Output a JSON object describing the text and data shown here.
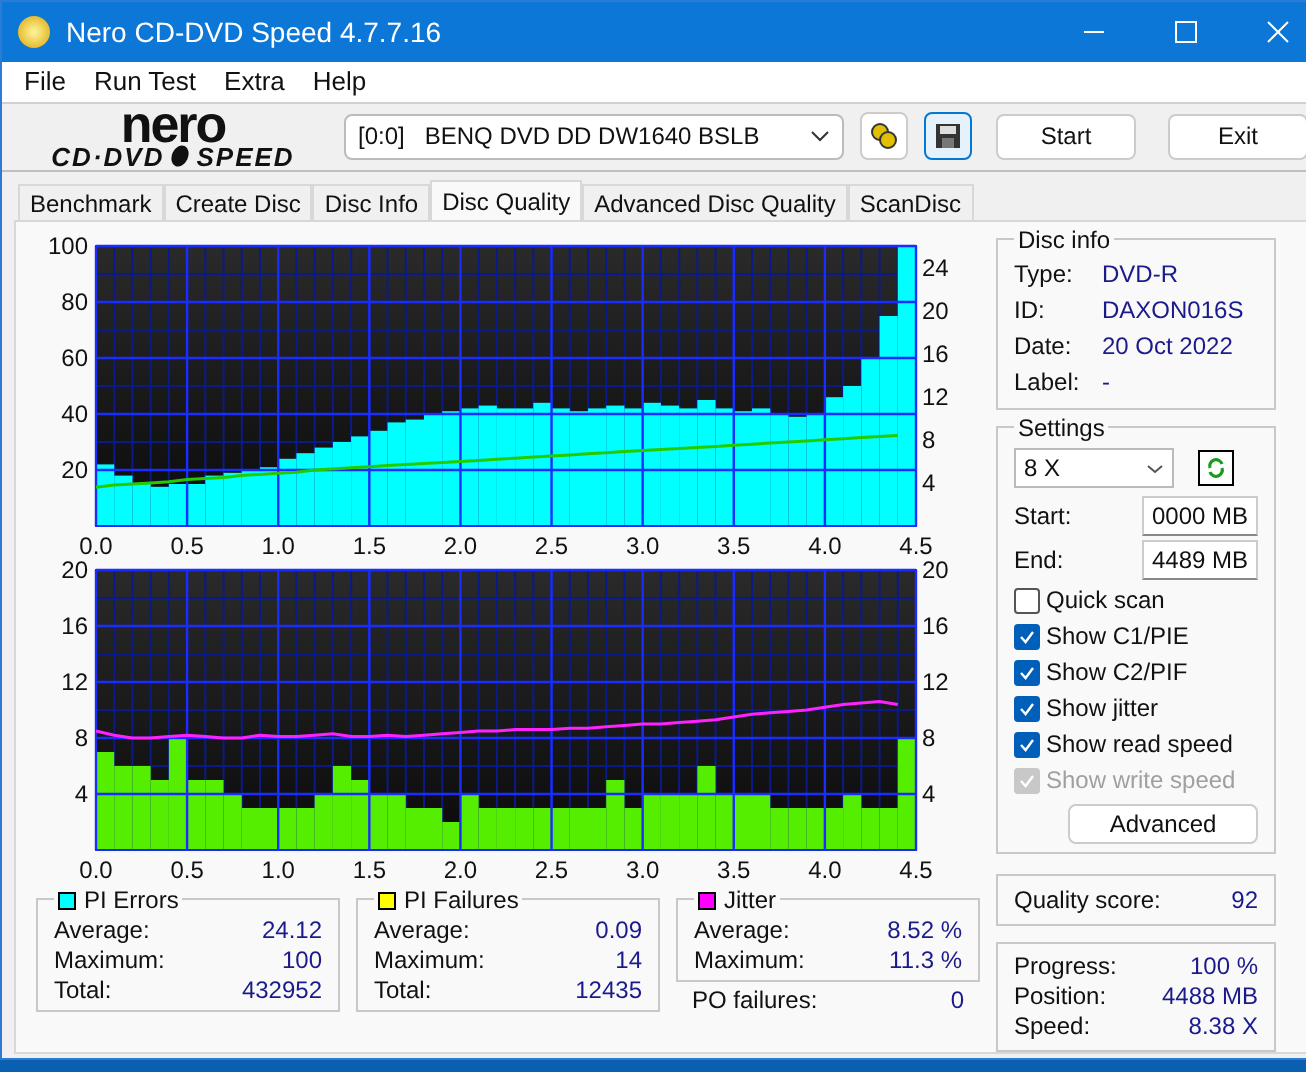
{
  "window": {
    "title": "Nero CD-DVD Speed 4.7.7.16"
  },
  "menu": [
    "File",
    "Run Test",
    "Extra",
    "Help"
  ],
  "toolbar": {
    "logo_top": "nero",
    "logo_bottom": "CD·DVD",
    "logo_speed": "SPEED",
    "drive": "[0:0]   BENQ DVD DD DW1640 BSLB",
    "start": "Start",
    "exit": "Exit"
  },
  "tabs": [
    {
      "label": "Benchmark",
      "selected": false
    },
    {
      "label": "Create Disc",
      "selected": false
    },
    {
      "label": "Disc Info",
      "selected": false
    },
    {
      "label": "Disc Quality",
      "selected": true
    },
    {
      "label": "Advanced Disc Quality",
      "selected": false
    },
    {
      "label": "ScanDisc",
      "selected": false
    }
  ],
  "charts": [
    {
      "chart_data": {
        "type": "bar",
        "grid": true,
        "xlim": [
          0,
          4.5
        ],
        "ylim": [
          0,
          100
        ],
        "xticks": [
          {
            "value": 0,
            "label": "0.0"
          },
          {
            "value": 0.5,
            "label": "0.5"
          },
          {
            "value": 1,
            "label": "1.0"
          },
          {
            "value": 1.5,
            "label": "1.5"
          },
          {
            "value": 2,
            "label": "2.0"
          },
          {
            "value": 2.5,
            "label": "2.5"
          },
          {
            "value": 3,
            "label": "3.0"
          },
          {
            "value": 3.5,
            "label": "3.5"
          },
          {
            "value": 4,
            "label": "4.0"
          },
          {
            "value": 4.5,
            "label": "4.5"
          }
        ],
        "yticks": [
          20,
          40,
          60,
          80,
          100
        ],
        "x": [
          0.05,
          0.15,
          0.25,
          0.35,
          0.45,
          0.55,
          0.65,
          0.75,
          0.85,
          0.95,
          1.05,
          1.15,
          1.25,
          1.35,
          1.45,
          1.55,
          1.65,
          1.75,
          1.85,
          1.95,
          2.05,
          2.15,
          2.25,
          2.35,
          2.45,
          2.55,
          2.65,
          2.75,
          2.85,
          2.95,
          3.05,
          3.15,
          3.25,
          3.35,
          3.45,
          3.55,
          3.65,
          3.75,
          3.85,
          3.95,
          4.05,
          4.15,
          4.25,
          4.35,
          4.45
        ],
        "series": [
          {
            "color": "#00ffff",
            "values": [
              22,
              18,
              15,
              14,
              15,
              15,
              18,
              19,
              20,
              21,
              24,
              26,
              28,
              30,
              32,
              34,
              37,
              38,
              40,
              41,
              42,
              43,
              42,
              42,
              44,
              42,
              41,
              42,
              43,
              42,
              44,
              43,
              42,
              45,
              42,
              41,
              42,
              40,
              39,
              40,
              46,
              50,
              60,
              75,
              100
            ]
          }
        ]
      },
      "overlay": {
        "chart_data": {
          "type": "line",
          "xlim": [
            0,
            4.5
          ],
          "ylim": [
            0,
            26
          ],
          "yticks": [
            4,
            8,
            12,
            16,
            20,
            24
          ],
          "x": [
            0,
            0.1,
            0.2,
            0.3,
            0.4,
            0.5,
            0.6,
            0.7,
            0.8,
            0.9,
            1,
            1.1,
            1.2,
            1.3,
            1.4,
            1.5,
            1.6,
            1.7,
            1.8,
            1.9,
            2,
            2.1,
            2.2,
            2.3,
            2.4,
            2.5,
            2.6,
            2.7,
            2.8,
            2.9,
            3,
            3.1,
            3.2,
            3.3,
            3.4,
            3.5,
            3.6,
            3.7,
            3.8,
            3.9,
            4,
            4.1,
            4.2,
            4.3,
            4.4
          ],
          "series": [
            {
              "color": "#22cc00",
              "values": [
                3.6,
                3.8,
                3.9,
                4.0,
                4.1,
                4.3,
                4.4,
                4.5,
                4.7,
                4.8,
                4.9,
                5.0,
                5.2,
                5.3,
                5.4,
                5.5,
                5.6,
                5.7,
                5.8,
                5.9,
                6.0,
                6.1,
                6.2,
                6.3,
                6.4,
                6.5,
                6.6,
                6.7,
                6.8,
                6.9,
                7.0,
                7.1,
                7.2,
                7.3,
                7.4,
                7.5,
                7.6,
                7.7,
                7.8,
                7.9,
                8.0,
                8.1,
                8.2,
                8.3,
                8.4
              ]
            }
          ]
        }
      }
    },
    {
      "chart_data": {
        "type": "bar",
        "grid": true,
        "xlim": [
          0,
          4.5
        ],
        "ylim": [
          0,
          20
        ],
        "xticks": [
          {
            "value": 0,
            "label": "0.0"
          },
          {
            "value": 0.5,
            "label": "0.5"
          },
          {
            "value": 1,
            "label": "1.0"
          },
          {
            "value": 1.5,
            "label": "1.5"
          },
          {
            "value": 2,
            "label": "2.0"
          },
          {
            "value": 2.5,
            "label": "2.5"
          },
          {
            "value": 3,
            "label": "3.0"
          },
          {
            "value": 3.5,
            "label": "3.5"
          },
          {
            "value": 4,
            "label": "4.0"
          },
          {
            "value": 4.5,
            "label": "4.5"
          }
        ],
        "yticks": [
          4,
          8,
          12,
          16,
          20
        ],
        "x": [
          0.05,
          0.15,
          0.25,
          0.35,
          0.45,
          0.55,
          0.65,
          0.75,
          0.85,
          0.95,
          1.05,
          1.15,
          1.25,
          1.35,
          1.45,
          1.55,
          1.65,
          1.75,
          1.85,
          1.95,
          2.05,
          2.15,
          2.25,
          2.35,
          2.45,
          2.55,
          2.65,
          2.75,
          2.85,
          2.95,
          3.05,
          3.15,
          3.25,
          3.35,
          3.45,
          3.55,
          3.65,
          3.75,
          3.85,
          3.95,
          4.05,
          4.15,
          4.25,
          4.35,
          4.45
        ],
        "series": [
          {
            "color": "#55ee00",
            "values": [
              7,
              6,
              6,
              5,
              8,
              5,
              5,
              4,
              3,
              3,
              3,
              3,
              4,
              6,
              5,
              4,
              4,
              3,
              3,
              2,
              4,
              3,
              3,
              3,
              3,
              3,
              3,
              3,
              5,
              3,
              4,
              4,
              4,
              6,
              4,
              4,
              4,
              3,
              3,
              3,
              3,
              4,
              3,
              3,
              8
            ]
          }
        ]
      },
      "overlay": {
        "chart_data": {
          "type": "line",
          "xlim": [
            0,
            4.5
          ],
          "ylim": [
            0,
            20
          ],
          "yticks": [
            4,
            8,
            12,
            16,
            20
          ],
          "x": [
            0,
            0.1,
            0.2,
            0.3,
            0.4,
            0.5,
            0.6,
            0.7,
            0.8,
            0.9,
            1,
            1.1,
            1.2,
            1.3,
            1.4,
            1.5,
            1.6,
            1.7,
            1.8,
            1.9,
            2,
            2.1,
            2.2,
            2.3,
            2.4,
            2.5,
            2.6,
            2.7,
            2.8,
            2.9,
            3,
            3.1,
            3.2,
            3.3,
            3.4,
            3.5,
            3.6,
            3.7,
            3.8,
            3.9,
            4,
            4.1,
            4.2,
            4.3,
            4.4
          ],
          "series": [
            {
              "color": "#ff22ff",
              "values": [
                8.5,
                8.2,
                8.0,
                8.0,
                8.1,
                8.2,
                8.1,
                8.0,
                8.0,
                8.2,
                8.1,
                8.1,
                8.2,
                8.3,
                8.1,
                8.1,
                8.2,
                8.1,
                8.2,
                8.3,
                8.4,
                8.5,
                8.5,
                8.6,
                8.6,
                8.6,
                8.7,
                8.7,
                8.8,
                8.9,
                9.0,
                9.0,
                9.1,
                9.2,
                9.3,
                9.5,
                9.7,
                9.8,
                9.9,
                10.0,
                10.2,
                10.4,
                10.5,
                10.6,
                10.4
              ]
            }
          ]
        }
      }
    }
  ],
  "stats": [
    {
      "title": "PI Errors",
      "color": "#00ffff",
      "rows": [
        {
          "label": "Average:",
          "value": "24.12"
        },
        {
          "label": "Maximum:",
          "value": "100"
        },
        {
          "label": "Total:",
          "value": "432952"
        }
      ]
    },
    {
      "title": "PI Failures",
      "color": "#ffff00",
      "rows": [
        {
          "label": "Average:",
          "value": "0.09"
        },
        {
          "label": "Maximum:",
          "value": "14"
        },
        {
          "label": "Total:",
          "value": "12435"
        }
      ]
    },
    {
      "title": "Jitter",
      "color": "#ff00ff",
      "rows": [
        {
          "label": "Average:",
          "value": "8.52 %"
        },
        {
          "label": "Maximum:",
          "value": "11.3 %"
        }
      ]
    }
  ],
  "po_failures": {
    "label": "PO failures:",
    "value": "0"
  },
  "disc_info": {
    "title": "Disc info",
    "rows": [
      {
        "label": "Type:",
        "value": "DVD-R"
      },
      {
        "label": "ID:",
        "value": "DAXON016S"
      },
      {
        "label": "Date:",
        "value": "20 Oct 2022"
      },
      {
        "label": "Label:",
        "value": "-"
      }
    ]
  },
  "settings": {
    "title": "Settings",
    "speed": "8 X",
    "start_label": "Start:",
    "start": "0000 MB",
    "end_label": "End:",
    "end": "4489 MB",
    "options": [
      {
        "label": "Quick scan",
        "checked": false,
        "disabled": false
      },
      {
        "label": "Show C1/PIE",
        "checked": true,
        "disabled": false
      },
      {
        "label": "Show C2/PIF",
        "checked": true,
        "disabled": false
      },
      {
        "label": "Show jitter",
        "checked": true,
        "disabled": false
      },
      {
        "label": "Show read speed",
        "checked": true,
        "disabled": false
      },
      {
        "label": "Show write speed",
        "checked": true,
        "disabled": true
      }
    ],
    "advanced": "Advanced"
  },
  "quality": {
    "label": "Quality score:",
    "value": "92"
  },
  "progress": [
    {
      "label": "Progress:",
      "value": "100 %"
    },
    {
      "label": "Position:",
      "value": "4488 MB"
    },
    {
      "label": "Speed:",
      "value": "8.38 X"
    }
  ]
}
